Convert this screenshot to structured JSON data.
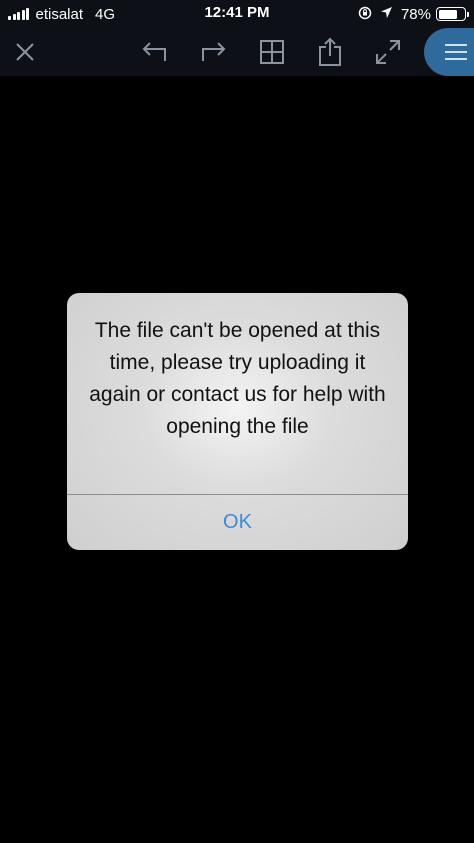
{
  "status_bar": {
    "carrier": "etisalat",
    "network": "4G",
    "time": "12:41 PM",
    "battery_percent": "78%",
    "battery_level": 0.78,
    "icons": [
      "signal-bars-icon",
      "rotation-lock-icon",
      "location-arrow-icon",
      "battery-icon"
    ]
  },
  "toolbar": {
    "icons": [
      "close-icon",
      "undo-icon",
      "redo-icon",
      "grid-icon",
      "share-icon",
      "fullscreen-icon",
      "menu-icon"
    ],
    "accent_color": "#2f6a9c"
  },
  "dialog": {
    "message": "The file can't be opened at this time, please try uploading it again or contact us for help with opening the file",
    "ok_label": "OK",
    "ok_color": "#3f8ad4"
  }
}
